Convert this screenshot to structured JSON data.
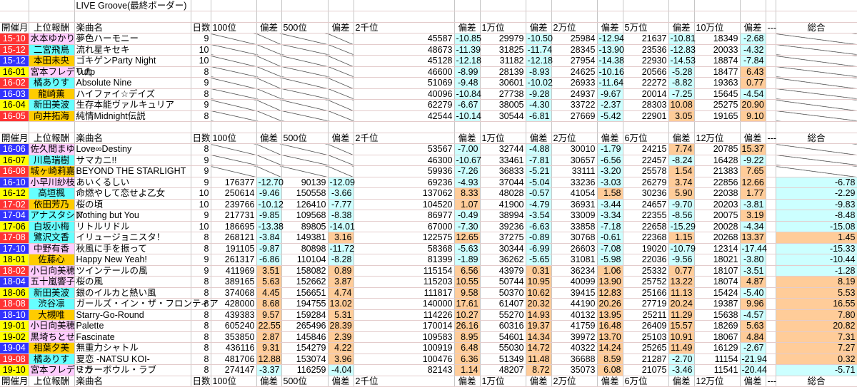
{
  "title": "LIVE Groove(最終ボーダー)",
  "colors": {
    "red": "#ff3333",
    "blue": "#3333ff",
    "yellow": "#ffff00",
    "pink": "#ffccff",
    "cyan": "#66ffff",
    "orange": "#ffcc00",
    "negative": "#ccffff",
    "positive": "#ffcc99"
  },
  "sections": [
    {
      "header": [
        "開催月",
        "上位報酬",
        "楽曲名",
        "日数",
        "100位",
        "偏差",
        "500位",
        "偏差",
        "2千位",
        "偏差",
        "1万位",
        "偏差",
        "2万位",
        "偏差",
        "5万位",
        "偏差",
        "10万位",
        "偏差",
        "---",
        "総合"
      ],
      "rows": [
        {
          "month": "15-10",
          "month_color": "red",
          "reward": "水本ゆかり",
          "reward_color": "pink",
          "song": "夢色ハーモニー",
          "days": "9",
          "ranks": [
            null,
            null,
            "45587",
            "29979",
            "25984",
            "21637",
            "18349"
          ],
          "devs": [
            null,
            null,
            "-10.85",
            "-10.50",
            "-12.94",
            "-10.81",
            "-2.68"
          ],
          "total": null
        },
        {
          "month": "15-12",
          "month_color": "red",
          "reward": "二宮飛鳥",
          "reward_color": "cyan",
          "song": "流れ星キセキ",
          "days": "10",
          "ranks": [
            null,
            null,
            "48673",
            "31825",
            "28345",
            "23536",
            "20033"
          ],
          "devs": [
            null,
            null,
            "-11.39",
            "-11.74",
            "-13.90",
            "-12.83",
            "-4.32"
          ],
          "total": null
        },
        {
          "month": "15-12",
          "month_color": "blue",
          "reward": "本田未央",
          "reward_color": "orange",
          "song": "ゴキゲンParty Night",
          "days": "10",
          "ranks": [
            null,
            null,
            "45128",
            "31182",
            "27954",
            "22930",
            "18874"
          ],
          "devs": [
            null,
            null,
            "-12.18",
            "-12.18",
            "-14.38",
            "-14.53",
            "-7.84"
          ],
          "total": null
        },
        {
          "month": "16-01",
          "month_color": "yellow",
          "reward": "宮本フレデリカ",
          "reward_color": "pink",
          "song": "Tulip",
          "days": "8",
          "ranks": [
            null,
            null,
            "46600",
            "28139",
            "24625",
            "20566",
            "18477"
          ],
          "devs": [
            null,
            null,
            "-8.99",
            "-8.93",
            "-10.16",
            "-5.28",
            "6.43"
          ],
          "total": null
        },
        {
          "month": "16-02",
          "month_color": "red",
          "reward": "橘ありす",
          "reward_color": "cyan",
          "song": "Absolute Nine",
          "days": "9",
          "ranks": [
            null,
            null,
            "51069",
            "30601",
            "26933",
            "22272",
            "19363"
          ],
          "devs": [
            null,
            null,
            "-9.48",
            "-10.02",
            "-11.64",
            "-8.82",
            "0.77"
          ],
          "total": null
        },
        {
          "month": "16-03",
          "month_color": "blue",
          "reward": "龍崎薫",
          "reward_color": "orange",
          "song": "ハイファイ☆デイズ",
          "days": "8",
          "ranks": [
            null,
            null,
            "40096",
            "27738",
            "24937",
            "20014",
            "15645"
          ],
          "devs": [
            null,
            null,
            "-10.84",
            "-9.28",
            "-9.67",
            "-7.25",
            "-4.54"
          ],
          "total": null
        },
        {
          "month": "16-04",
          "month_color": "yellow",
          "reward": "新田美波",
          "reward_color": "cyan",
          "song": "生存本能ヴァルキュリア",
          "days": "9",
          "ranks": [
            null,
            null,
            "62279",
            "38005",
            "33722",
            "28303",
            "25275"
          ],
          "devs": [
            null,
            null,
            "-6.67",
            "-4.30",
            "-2.37",
            "10.08",
            "20.90"
          ],
          "total": null
        },
        {
          "month": "16-05",
          "month_color": "red",
          "reward": "向井拓海",
          "reward_color": "orange",
          "song": "純情Midnight伝説",
          "days": "8",
          "ranks": [
            null,
            null,
            "42544",
            "30544",
            "27669",
            "22901",
            "19165"
          ],
          "devs": [
            null,
            null,
            "-10.14",
            "-6.81",
            "-5.42",
            "3.05",
            "9.10"
          ],
          "total": null
        }
      ]
    },
    {
      "header": [
        "開催月",
        "上位報酬",
        "楽曲名",
        "日数",
        "100位",
        "偏差",
        "500位",
        "偏差",
        "2千位",
        "偏差",
        "1万位",
        "偏差",
        "2万位",
        "偏差",
        "6万位",
        "偏差",
        "12万位",
        "偏差",
        "---",
        "総合"
      ],
      "rows": [
        {
          "month": "16-06",
          "month_color": "blue",
          "reward": "佐久間まゆ",
          "reward_color": "pink",
          "song": "Love∞Destiny",
          "days": "8",
          "ranks": [
            null,
            null,
            "53567",
            "32744",
            "30010",
            "24215",
            "20785"
          ],
          "devs": [
            null,
            null,
            "-7.00",
            "-4.88",
            "-1.79",
            "7.74",
            "15.37"
          ],
          "total": null
        },
        {
          "month": "16-07",
          "month_color": "yellow",
          "reward": "川島瑞樹",
          "reward_color": "cyan",
          "song": "サマカニ!!",
          "days": "9",
          "ranks": [
            null,
            null,
            "46300",
            "33461",
            "30657",
            "22457",
            "16428"
          ],
          "devs": [
            null,
            null,
            "-10.67",
            "-7.81",
            "-6.56",
            "-8.24",
            "-9.22"
          ],
          "total": null
        },
        {
          "month": "16-08",
          "month_color": "red",
          "reward": "城ヶ崎莉嘉",
          "reward_color": "orange",
          "song": "BEYOND THE STARLIGHT",
          "days": "9",
          "ranks": [
            null,
            null,
            "59936",
            "36833",
            "33111",
            "25578",
            "21383"
          ],
          "devs": [
            null,
            null,
            "-7.26",
            "-5.21",
            "-3.20",
            "1.54",
            "7.65"
          ],
          "total": null
        },
        {
          "month": "16-10",
          "month_color": "blue",
          "reward": "小早川紗枝",
          "reward_color": "pink",
          "song": "あいくるしい",
          "days": "9",
          "ranks": [
            "176377",
            "90139",
            "69236",
            "37044",
            "33236",
            "26279",
            "22856"
          ],
          "devs": [
            "-12.70",
            "-12.09",
            "-4.93",
            "-5.04",
            "-3.03",
            "3.74",
            "12.66"
          ],
          "total": "-6.78"
        },
        {
          "month": "16-12",
          "month_color": "yellow",
          "reward": "高垣楓",
          "reward_color": "cyan",
          "song": "命燃やして恋せよ乙女",
          "days": "10",
          "ranks": [
            "250614",
            "150558",
            "137062",
            "48028",
            "41054",
            "30236",
            "22038"
          ],
          "devs": [
            "-9.46",
            "-3.66",
            "8.33",
            "-0.57",
            "1.58",
            "5.90",
            "1.77"
          ],
          "total": "-2.29"
        },
        {
          "month": "17-02",
          "month_color": "red",
          "reward": "依田芳乃",
          "reward_color": "orange",
          "song": "桜の頃",
          "days": "10",
          "ranks": [
            "239766",
            "126410",
            "104520",
            "41900",
            "36931",
            "24657",
            "20203"
          ],
          "devs": [
            "-10.12",
            "-7.77",
            "1.07",
            "-4.79",
            "-3.44",
            "-9.70",
            "-3.81"
          ],
          "total": "-9.83"
        },
        {
          "month": "17-04",
          "month_color": "blue",
          "reward": "アナスタシア",
          "reward_color": "cyan",
          "song": "Nothing but You",
          "days": "9",
          "ranks": [
            "217731",
            "109568",
            "86977",
            "38994",
            "33009",
            "22355",
            "20075"
          ],
          "devs": [
            "-9.85",
            "-8.38",
            "-0.49",
            "-3.54",
            "-3.34",
            "-8.56",
            "3.19"
          ],
          "total": "-8.48"
        },
        {
          "month": "17-06",
          "month_color": "yellow",
          "reward": "白坂小梅",
          "reward_color": "cyan",
          "song": "リトルリドル",
          "days": "10",
          "ranks": [
            "186695",
            "89805",
            "67000",
            "39236",
            "33858",
            "22658",
            "20028"
          ],
          "devs": [
            "-13.38",
            "-14.01",
            "-7.30",
            "-6.63",
            "-7.18",
            "-15.29",
            "-4.34"
          ],
          "total": "-15.08"
        },
        {
          "month": "17-08",
          "month_color": "red",
          "reward": "鷺沢文香",
          "reward_color": "cyan",
          "song": "イリュージョニスタ！",
          "days": "8",
          "ranks": [
            "268121",
            "149381",
            "122575",
            "37275",
            "30768",
            "22368",
            "20268"
          ],
          "devs": [
            "-3.84",
            "3.16",
            "12.65",
            "-0.89",
            "-0.61",
            "1.15",
            "13.37"
          ],
          "total": "1.45"
        },
        {
          "month": "17-10",
          "month_color": "blue",
          "reward": "中野有香",
          "reward_color": "pink",
          "song": "秋風に手を振って",
          "days": "8",
          "ranks": [
            "191105",
            "80898",
            "58368",
            "30344",
            "26603",
            "19020",
            "12314"
          ],
          "devs": [
            "-9.87",
            "-11.72",
            "-5.63",
            "-6.99",
            "-7.08",
            "-10.79",
            "-17.44"
          ],
          "total": "-15.33"
        },
        {
          "month": "18-01",
          "month_color": "yellow",
          "reward": "佐藤心",
          "reward_color": "orange",
          "song": "Happy New Yeah!",
          "days": "9",
          "ranks": [
            "261317",
            "110104",
            "81399",
            "36262",
            "31081",
            "22036",
            "18021"
          ],
          "devs": [
            "-6.86",
            "-8.28",
            "-1.89",
            "-5.65",
            "-5.98",
            "-9.56",
            "-3.80"
          ],
          "total": "-10.44"
        },
        {
          "month": "18-02",
          "month_color": "red",
          "reward": "小日向美穂",
          "reward_color": "pink",
          "song": "ツインテールの風",
          "days": "9",
          "ranks": [
            "411969",
            "158082",
            "115154",
            "43979",
            "36234",
            "25332",
            "18107"
          ],
          "devs": [
            "3.51",
            "0.89",
            "6.56",
            "0.31",
            "1.06",
            "0.77",
            "-3.51"
          ],
          "total": "-1.28"
        },
        {
          "month": "18-04",
          "month_color": "blue",
          "reward": "五十嵐響子",
          "reward_color": "pink",
          "song": "桜の風",
          "days": "8",
          "ranks": [
            "389165",
            "152662",
            "115203",
            "50744",
            "40099",
            "25752",
            "18074"
          ],
          "devs": [
            "5.63",
            "3.87",
            "10.55",
            "10.95",
            "13.90",
            "13.22",
            "4.87"
          ],
          "total": "8.19"
        },
        {
          "month": "18-06",
          "month_color": "yellow",
          "reward": "新田美波",
          "reward_color": "cyan",
          "song": "銀のイルカと熱い風",
          "days": "8",
          "ranks": [
            "374068",
            "156651",
            "111817",
            "50370",
            "39415",
            "25166",
            "15424"
          ],
          "devs": [
            "4.45",
            "4.74",
            "9.58",
            "10.62",
            "12.83",
            "11.13",
            "-5.40"
          ],
          "total": "5.53"
        },
        {
          "month": "18-08",
          "month_color": "red",
          "reward": "渋谷凛",
          "reward_color": "cyan",
          "song": "ガールズ・イン・ザ・フロンティア",
          "days": "8",
          "ranks": [
            "428000",
            "194755",
            "140000",
            "61407",
            "44190",
            "27719",
            "19387"
          ],
          "devs": [
            "8.68",
            "13.02",
            "17.61",
            "20.32",
            "20.26",
            "20.24",
            "9.96"
          ],
          "total": "16.55"
        },
        {
          "month": "18-10",
          "month_color": "blue",
          "reward": "大槻唯",
          "reward_color": "orange",
          "song": "Starry-Go-Round",
          "days": "8",
          "ranks": [
            "439383",
            "159284",
            "114226",
            "55270",
            "40132",
            "25211",
            "15638"
          ],
          "devs": [
            "9.57",
            "5.31",
            "10.27",
            "14.93",
            "13.95",
            "11.29",
            "-4.57"
          ],
          "total": "7.80"
        },
        {
          "month": "19-01",
          "month_color": "yellow",
          "reward": "小日向美穂",
          "reward_color": "pink",
          "song": "Palette",
          "days": "8",
          "ranks": [
            "605240",
            "265496",
            "170014",
            "60316",
            "41759",
            "26409",
            "18269"
          ],
          "devs": [
            "22.55",
            "28.39",
            "26.16",
            "19.37",
            "16.48",
            "15.57",
            "5.63"
          ],
          "total": "20.82"
        },
        {
          "month": "19-02",
          "month_color": "yellow",
          "reward": "黒埼ちとせ",
          "reward_color": "pink",
          "song": "Fascinate",
          "days": "8",
          "ranks": [
            "353850",
            "145846",
            "109583",
            "54601",
            "39972",
            "25103",
            "18067"
          ],
          "devs": [
            "2.87",
            "2.39",
            "8.95",
            "14.34",
            "13.70",
            "10.91",
            "4.84"
          ],
          "total": "7.31"
        },
        {
          "month": "19-04",
          "month_color": "blue",
          "reward": "相葉夕美",
          "reward_color": "orange",
          "song": "無重力シャトル",
          "days": "8",
          "ranks": [
            "436116",
            "154279",
            "100919",
            "55030",
            "40322",
            "25265",
            "16129"
          ],
          "devs": [
            "9.31",
            "4.22",
            "6.48",
            "14.72",
            "14.24",
            "11.49",
            "-2.67"
          ],
          "total": "7.27"
        },
        {
          "month": "19-08",
          "month_color": "red",
          "reward": "橘ありす",
          "reward_color": "cyan",
          "song": "夏恋 -NATSU KOI-",
          "days": "8",
          "ranks": [
            "481706",
            "153074",
            "100476",
            "51349",
            "36688",
            "21287",
            "11154"
          ],
          "devs": [
            "12.88",
            "3.96",
            "6.36",
            "11.48",
            "8.59",
            "-2.70",
            "-21.94"
          ],
          "total": "0.32"
        },
        {
          "month": "19-10",
          "month_color": "yellow",
          "reward": "宮本フレデリカ",
          "reward_color": "pink",
          "song": "ミラーボウル・ラブ",
          "days": "8",
          "ranks": [
            "274147",
            "116259",
            "82143",
            "48207",
            "35073",
            "21075",
            "11541"
          ],
          "devs": [
            "-3.37",
            "-4.04",
            "1.14",
            "8.72",
            "6.08",
            "-3.46",
            "-20.44"
          ],
          "total": "-5.71"
        }
      ]
    }
  ],
  "footer_header": [
    "開催月",
    "上位報酬",
    "楽曲名",
    "日数",
    "100位",
    "偏差",
    "500位",
    "偏差",
    "2千位",
    "偏差",
    "1万位",
    "偏差",
    "2万位",
    "偏差",
    "6万位",
    "偏差",
    "12万位",
    "偏差",
    "---",
    "総合"
  ]
}
